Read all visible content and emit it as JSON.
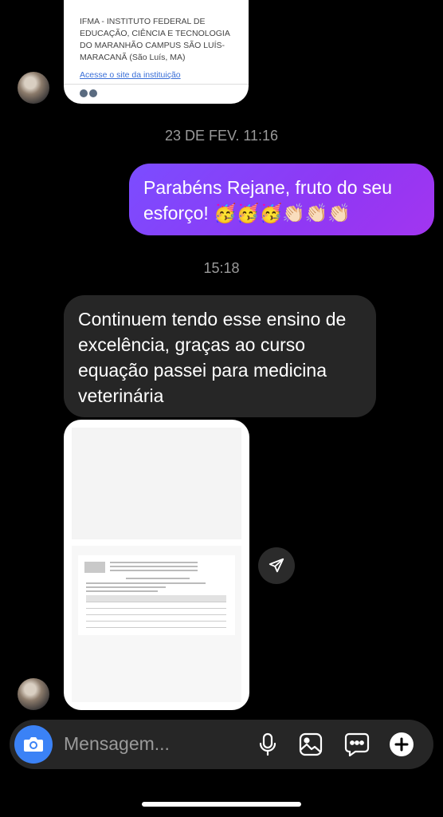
{
  "shared_card": {
    "institution": "IFMA - INSTITUTO FEDERAL DE EDUCAÇÃO, CIÊNCIA E TECNOLOGIA DO MARANHÃO CAMPUS SÃO LUÍS-MARACANÃ (São Luís, MA)",
    "link": "Acesse o site da instituição"
  },
  "timestamps": {
    "first": "23 DE FEV. 11:16",
    "second": "15:18"
  },
  "messages": {
    "outgoing_text": "Parabéns Rejane, fruto do seu esforço! 🥳🥳🥳👏🏻👏🏻👏🏻",
    "incoming_text": "Continuem tendo esse ensino de excelência, graças ao curso equação passei para medicina veterinária"
  },
  "composer": {
    "placeholder": "Mensagem..."
  },
  "icons": [
    "camera-icon",
    "microphone-icon",
    "gallery-icon",
    "sticker-icon",
    "plus-icon",
    "share-icon"
  ],
  "colors": {
    "outgoing_bubble": "#8f38f4",
    "incoming_bubble": "#262626",
    "camera": "#3b82f6"
  }
}
